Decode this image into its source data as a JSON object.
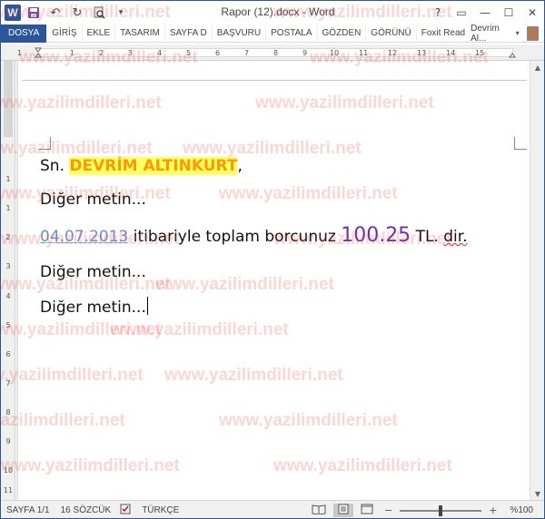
{
  "titlebar": {
    "title": "Rapor (12).docx - Word",
    "qat_icons": [
      "word-icon",
      "save-icon",
      "undo-icon",
      "redo-icon",
      "print-preview-icon",
      "customize-icon"
    ],
    "help": "?",
    "ribbon_display": "▭",
    "minimize": "—",
    "maximize": "☐",
    "close": "✕"
  },
  "ribbon": {
    "tabs": [
      "DOSYA",
      "GİRİŞ",
      "EKLE",
      "TASARIM",
      "SAYFA D",
      "BAŞVURU",
      "POSTALA",
      "GÖZDEN",
      "GÖRÜNÜ",
      "Foxit Read"
    ],
    "user": "Devrim Al..."
  },
  "ruler": {
    "h_numbers": [
      "1",
      "1",
      "2",
      "3",
      "4",
      "5",
      "6",
      "7",
      "8",
      "9",
      "10",
      "11",
      "12",
      "13",
      "14",
      "15"
    ],
    "v_numbers": [
      "2",
      "1",
      "1",
      "2",
      "3",
      "4",
      "5",
      "6",
      "7",
      "8",
      "9",
      "10",
      "11"
    ]
  },
  "document": {
    "salutation_prefix": "Sn. ",
    "name": "DEVRİM ALTINKURT",
    "comma": ",",
    "line2": "Diğer metin...",
    "date": "04.07.2013",
    "mid_text": " itibariyle toplam borcunuz ",
    "amount": "100.25",
    "currency": " TL. ",
    "dir": "dir.",
    "line4": "Diğer metin...",
    "line5": "Diğer metin..."
  },
  "status": {
    "page": "SAYFA 1/1",
    "words": "16 SÖZCÜK",
    "language": "TÜRKÇE",
    "zoom": "%100",
    "zoom_minus": "−",
    "zoom_plus": "+",
    "zoom_fraction": 0.5
  },
  "watermark": "www.yazilimdilleri.net",
  "colors": {
    "brand": "#2b579a",
    "highlight": "#ffff66",
    "name_text": "#ff9900",
    "amount": "#7030a0",
    "date": "#6b8fc4"
  }
}
